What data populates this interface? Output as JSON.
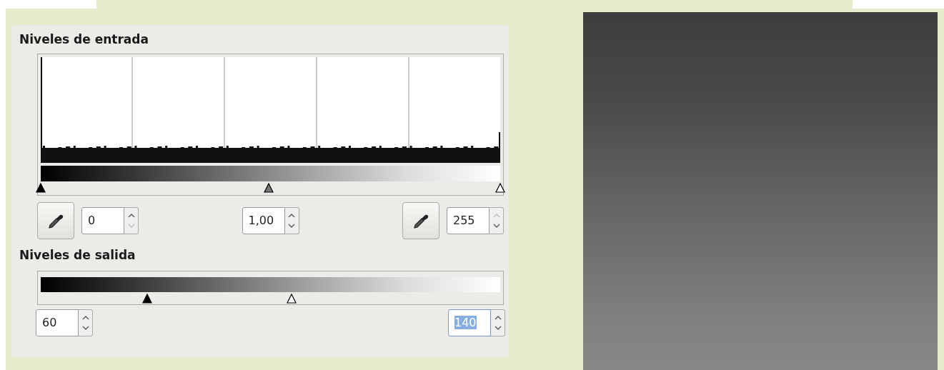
{
  "input_levels": {
    "title": "Niveles de entrada",
    "sliders": [
      {
        "kind": "black",
        "level": 0
      },
      {
        "kind": "gray",
        "level": 0.496
      },
      {
        "kind": "white",
        "level": 1
      }
    ],
    "groups": [
      [
        {
          "kind": "picker"
        },
        {
          "kind": "spin",
          "value": "0",
          "selected": false,
          "up_disabled": false,
          "down_disabled": true
        }
      ],
      [
        {
          "kind": "spin",
          "value": "1,00",
          "selected": false,
          "up_disabled": false,
          "down_disabled": false
        }
      ],
      [
        {
          "kind": "picker"
        },
        {
          "kind": "spin",
          "value": "255",
          "selected": false,
          "up_disabled": true,
          "down_disabled": false
        }
      ]
    ]
  },
  "output_levels": {
    "title": "Niveles de salida",
    "sliders": [
      {
        "kind": "black",
        "level": 0.232
      },
      {
        "kind": "white",
        "level": 0.546
      }
    ],
    "groups": [
      [
        {
          "kind": "spin",
          "value": "60",
          "selected": false,
          "up_disabled": false,
          "down_disabled": false
        }
      ],
      [
        {
          "kind": "spin",
          "value": "140",
          "selected": true,
          "up_disabled": false,
          "down_disabled": false
        }
      ]
    ]
  }
}
